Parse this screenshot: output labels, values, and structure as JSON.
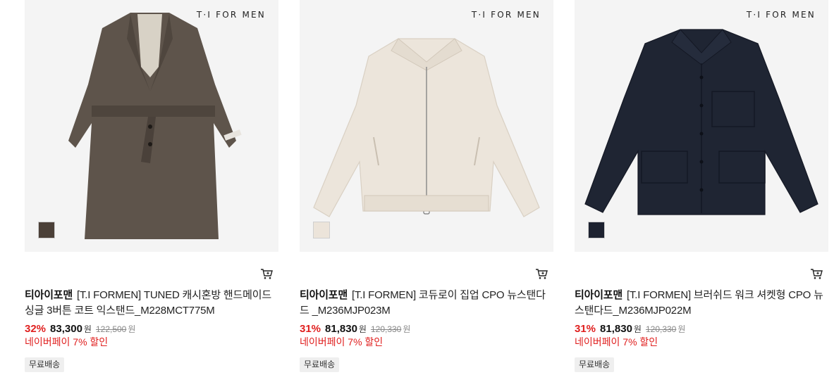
{
  "products": [
    {
      "brand_mark": "T·I FOR MEN",
      "mall": "티아이포맨",
      "name": "[T.I FORMEN] TUNED 캐시혼방 핸드메이드 싱글 3버튼 코트 익스탠드_M228MCT775M",
      "discount": "32%",
      "price": "83,300",
      "price_unit": "원",
      "original_price": "122,500",
      "original_unit": "원",
      "pay_benefit": "네이버페이 7% 할인",
      "shipping": "무료배송",
      "swatch_color": "#4b4038",
      "garment_color": "#5e544b",
      "icon": "cart-icon"
    },
    {
      "brand_mark": "T·I FOR MEN",
      "mall": "티아이포맨",
      "name": "[T.I FORMEN] 코듀로이 집업 CPO 뉴스탠다드 _M236MJP023M",
      "discount": "31%",
      "price": "81,830",
      "price_unit": "원",
      "original_price": "120,330",
      "original_unit": "원",
      "pay_benefit": "네이버페이 7% 할인",
      "shipping": "무료배송",
      "swatch_color": "#ece4da",
      "garment_color": "#ece5db",
      "icon": "cart-icon"
    },
    {
      "brand_mark": "T·I FOR MEN",
      "mall": "티아이포맨",
      "name": "[T.I FORMEN] 브러쉬드 워크 셔켓형 CPO 뉴스탠다드_M236MJP022M",
      "discount": "31%",
      "price": "81,830",
      "price_unit": "원",
      "original_price": "120,330",
      "original_unit": "원",
      "pay_benefit": "네이버페이 7% 할인",
      "shipping": "무료배송",
      "swatch_color": "#1d2230",
      "garment_color": "#1f2533",
      "icon": "cart-icon"
    }
  ],
  "colors": {
    "sale_red": "#e0201f",
    "thumb_bg": "#f4f4f4"
  }
}
